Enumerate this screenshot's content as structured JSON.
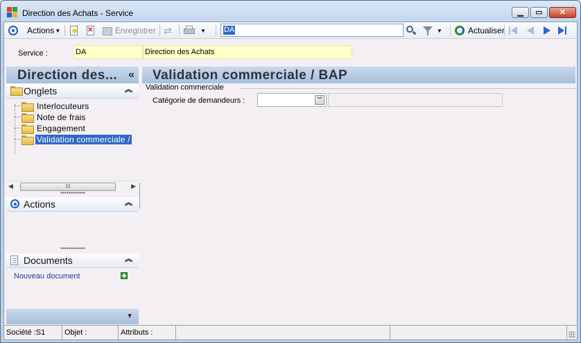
{
  "window": {
    "title": "Direction des Achats -  Service"
  },
  "toolbar": {
    "actions_label": "Actions",
    "save_label": "Enregistrer",
    "search_value": "DA",
    "refresh_label": "Actualiser"
  },
  "service": {
    "label": "Service :",
    "code": "DA",
    "name": "Direction des Achats"
  },
  "left": {
    "header": "Direction des...",
    "collapse_glyph": "«",
    "onglets": {
      "title": "Onglets",
      "items": [
        {
          "label": "Interlocuteurs"
        },
        {
          "label": "Note de frais"
        },
        {
          "label": "Engagement"
        },
        {
          "label": "Validation commerciale /"
        }
      ]
    },
    "scroll_thumb": "III",
    "actions": {
      "title": "Actions"
    },
    "documents": {
      "title": "Documents",
      "new_link": "Nouveau document"
    }
  },
  "main": {
    "header": "Validation commerciale / BAP",
    "group_title": "Validation commerciale",
    "category_label": "Catégorie de demandeurs :",
    "category_value": ""
  },
  "statusbar": {
    "societe": "Société :S1",
    "objet": "Objet :",
    "attributs": "Attributs :"
  },
  "colors": {
    "accent": "#3169c6",
    "header_gradient_top": "#c9d8ec",
    "header_gradient_bottom": "#a8bedc",
    "field_yellow": "#ffffc8",
    "pane_bg": "#f3eff3"
  },
  "icons": {
    "app": "app-logo-icon",
    "actions": "target-icon",
    "new": "new-document-icon",
    "delete": "delete-icon",
    "save": "save-icon",
    "refresh": "refresh-icon",
    "print": "print-icon",
    "search": "search-icon",
    "filter": "filter-icon",
    "first": "first-record-icon",
    "previous": "previous-record-icon",
    "next": "next-record-icon",
    "last": "last-record-icon"
  }
}
